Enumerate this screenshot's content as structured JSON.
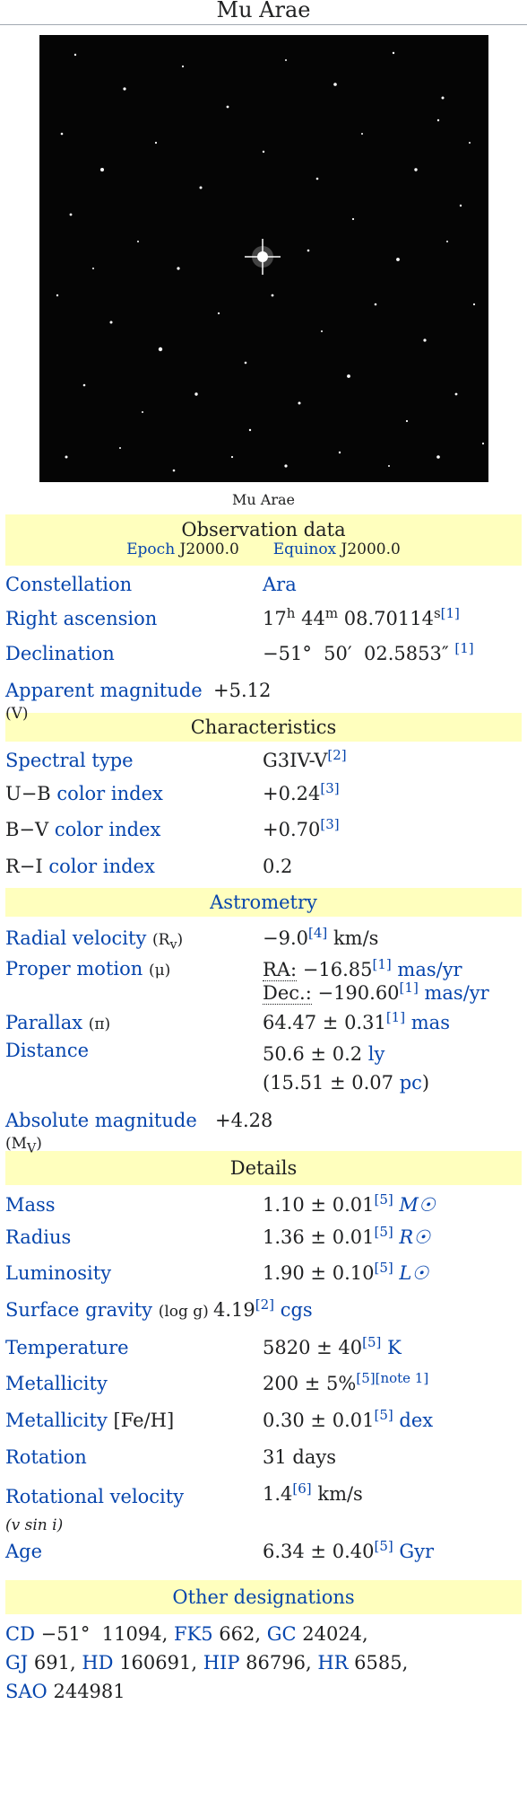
{
  "title": "Mu Arae",
  "image_caption": "Mu Arae",
  "observation": {
    "header": "Observation data",
    "epoch_label": "Epoch",
    "epoch_value": "J2000.0",
    "equinox_label": "Equinox",
    "equinox_value": "J2000.0",
    "constellation_label": "Constellation",
    "constellation_value": "Ara",
    "ra_label": "Right ascension",
    "ra_h": "17",
    "ra_m": "44",
    "ra_s": "08.70114",
    "ra_ref": "[1]",
    "dec_label": "Declination",
    "dec_value": "−51°  50′  02.5853″",
    "dec_ref": "[1]",
    "app_mag_label": "Apparent magnitude",
    "app_mag_sym": "(V)",
    "app_mag_value": "+5.12"
  },
  "characteristics": {
    "header": "Characteristics",
    "spectral_label": "Spectral type",
    "spectral_value": "G3IV-V",
    "spectral_ref": "[2]",
    "ub_label_prefix": "U−B",
    "ub_label": "color index",
    "ub_value": "+0.24",
    "ub_ref": "[3]",
    "bv_label_prefix": "B−V",
    "bv_label": "color index",
    "bv_value": "+0.70",
    "bv_ref": "[3]",
    "ri_label_prefix": "R−I",
    "ri_label": "color index",
    "ri_value": "0.2"
  },
  "astrometry": {
    "header": "Astrometry",
    "rv_label": "Radial velocity",
    "rv_sym": "(R",
    "rv_sym_sub": "v",
    "rv_sym_end": ")",
    "rv_value": "−9.0",
    "rv_ref": "[4]",
    "rv_unit": "km/s",
    "pm_label": "Proper motion",
    "pm_sym": "(μ)",
    "pm_ra_label": "RA:",
    "pm_ra_value": "−16.85",
    "pm_ra_ref": "[1]",
    "pm_ra_unit": "mas/yr",
    "pm_dec_label": "Dec.:",
    "pm_dec_value": "−190.60",
    "pm_dec_ref": "[1]",
    "pm_dec_unit": "mas/yr",
    "parallax_label": "Parallax",
    "parallax_sym": "(π)",
    "parallax_value": "64.47 ± 0.31",
    "parallax_ref": "[1]",
    "parallax_unit": "mas",
    "distance_label": "Distance",
    "distance_ly": "50.6 ± 0.2",
    "distance_ly_unit": "ly",
    "distance_pc": "(15.51 ± 0.07",
    "distance_pc_unit": "pc",
    "distance_pc_end": ")",
    "abs_mag_label": "Absolute magnitude",
    "abs_mag_sym": "(M",
    "abs_mag_sym_sub": "V",
    "abs_mag_sym_end": ")",
    "abs_mag_value": "+4.28"
  },
  "details": {
    "header": "Details",
    "mass_label": "Mass",
    "mass_value": "1.10 ± 0.01",
    "mass_ref": "[5]",
    "mass_unit": "M☉",
    "radius_label": "Radius",
    "radius_value": "1.36 ± 0.01",
    "radius_ref": "[5]",
    "radius_unit": "R☉",
    "lum_label": "Luminosity",
    "lum_value": "1.90 ± 0.10",
    "lum_ref": "[5]",
    "lum_unit": "L☉",
    "grav_label": "Surface gravity",
    "grav_sym": "(log g)",
    "grav_value": "4.19",
    "grav_ref": "[2]",
    "grav_unit": "cgs",
    "temp_label": "Temperature",
    "temp_value": "5820 ± 40",
    "temp_ref": "[5]",
    "temp_unit": "K",
    "metal_label": "Metallicity",
    "metal_value": "200 ± 5%",
    "metal_ref": "[5][note 1]",
    "metal_feh_label": "Metallicity",
    "metal_feh_sym": "[Fe/H]",
    "metal_feh_value": "0.30 ± 0.01",
    "metal_feh_ref": "[5]",
    "metal_feh_unit": "dex",
    "rotation_label": "Rotation",
    "rotation_value": "31 days",
    "rotvel_label": "Rotational velocity",
    "rotvel_sym": "(v sin i)",
    "rotvel_value": "1.4",
    "rotvel_ref": "[6]",
    "rotvel_unit": "km/s",
    "age_label": "Age",
    "age_value": "6.34 ± 0.40",
    "age_ref": "[5]",
    "age_unit": "Gyr"
  },
  "designations": {
    "header": "Other designations",
    "cd_label": "CD",
    "cd_value": "−51°  11094,",
    "fk5_label": "FK5",
    "fk5_value": "662,",
    "gc_label": "GC",
    "gc_value": "24024,",
    "gj_label": "GJ",
    "gj_value": "691,",
    "hd_label": "HD",
    "hd_value": "160691,",
    "hip_label": "HIP",
    "hip_value": "86796,",
    "hr_label": "HR",
    "hr_value": "6585,",
    "sao_label": "SAO",
    "sao_value": "244981"
  }
}
